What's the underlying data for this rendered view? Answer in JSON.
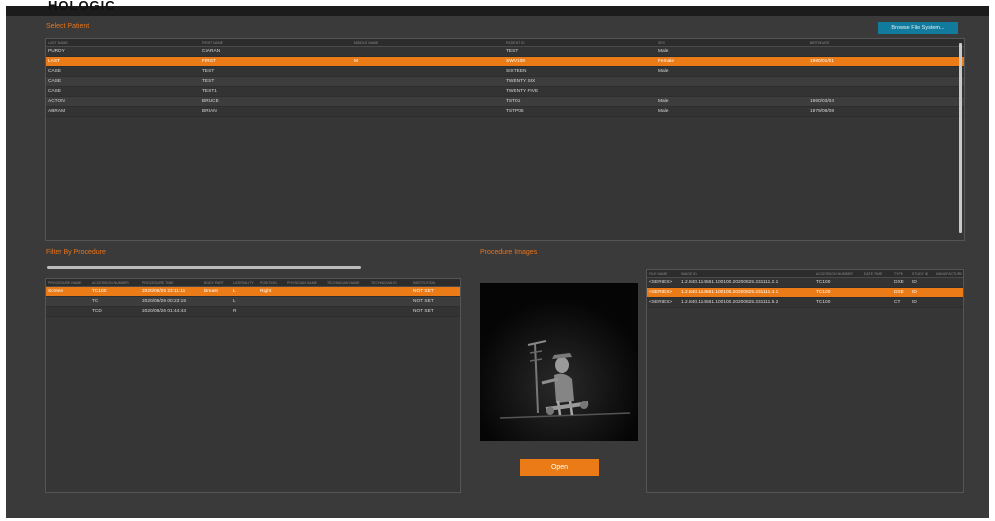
{
  "app": {
    "title": "HOLOGIC"
  },
  "select_patient": {
    "title": "Select Patient",
    "browse_label": "Browse File System...",
    "columns": [
      "LAST NAME",
      "FIRST NAME",
      "MIDDLE NAME",
      "PATIENT ID",
      "SEX",
      "BIRTHDATE"
    ],
    "rows": [
      [
        "PURDY",
        "CIARAN",
        "",
        "TEST",
        "Male",
        ""
      ],
      [
        "LAST",
        "FIRST",
        "M",
        "SWV108",
        "Female",
        "1980/01/01"
      ],
      [
        "CASE",
        "TEST",
        "",
        "SIXTEEN",
        "Male",
        ""
      ],
      [
        "CASE",
        "TEST",
        "",
        "TWENTY SIX",
        "",
        ""
      ],
      [
        "CASE",
        "TEST1",
        "",
        "TWENTY FIVE",
        "",
        ""
      ],
      [
        "ACTON",
        "BRUCE",
        "",
        "TST01",
        "Male",
        "1960/03/04"
      ],
      [
        "ABRAM",
        "BRIAN",
        "",
        "TSTP05",
        "Male",
        "1979/08/08"
      ]
    ],
    "selected_index": 1
  },
  "filter_procedure": {
    "title": "Filter By Procedure",
    "columns": [
      "PROCEDURE NAME",
      "ACCESSION NUMBER",
      "PROCEDURE TIME",
      "BODY PART",
      "LATERALITY",
      "POSITION",
      "PHYSICIAN NAME",
      "TECHNICIAN NAME",
      "TECHNICIAN ID",
      "INSTITUTION"
    ],
    "rows": [
      [
        "Screen",
        "TC100",
        "2020/08/25 23:11:11",
        "Breast",
        "L",
        "Right",
        "",
        "",
        "",
        "NOT SET"
      ],
      [
        "",
        "TC",
        "2020/08/26 00:23:15",
        "",
        "L",
        "",
        "",
        "",
        "",
        "NOT SET"
      ],
      [
        "",
        "TCD",
        "2020/08/26 01:44:43",
        "",
        "R",
        "",
        "",
        "",
        "",
        "NOT SET"
      ]
    ],
    "selected_index": 0
  },
  "procedure_images": {
    "title": "Procedure Images",
    "open_label": "Open",
    "columns": [
      "FILE NAME",
      "IMAGE ID",
      "ACCESSION NUMBER",
      "DATE TIME",
      "TYPE",
      "STUDY ID",
      "MANUFACTURER"
    ],
    "rows": [
      [
        "<SERIES>",
        "1.2.840.114561.100100.20200825.231111.2.1",
        "TC100",
        "",
        "DXE",
        "ID",
        ""
      ],
      [
        "<SERIES>",
        "1.2.840.114561.100100.20200825.231111.4.1",
        "TC100",
        "",
        "DXE",
        "ID",
        ""
      ],
      [
        "<SERIES>",
        "1.2.840.114561.100100.20200825.231111.5.2",
        "TC100",
        "",
        "CT",
        "ID",
        ""
      ]
    ],
    "selected_index": 1
  },
  "colors": {
    "accent": "#ea7b16",
    "browse": "#127a9c",
    "background": "#3a3a3b"
  }
}
